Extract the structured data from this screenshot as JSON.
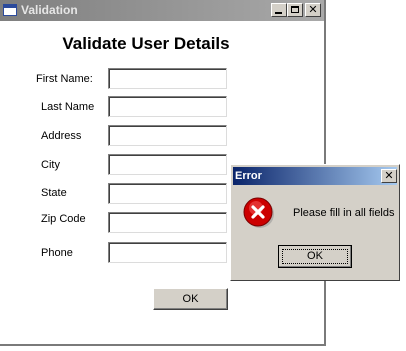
{
  "window": {
    "title": "Validation",
    "controls": {
      "minimize": "minimize-icon",
      "maximize": "maximize-icon",
      "close": "close-icon"
    }
  },
  "form": {
    "heading": "Validate User Details",
    "fields": [
      {
        "label": "First Name:",
        "value": ""
      },
      {
        "label": "Last Name",
        "value": ""
      },
      {
        "label": "Address",
        "value": ""
      },
      {
        "label": "City",
        "value": ""
      },
      {
        "label": "State",
        "value": ""
      },
      {
        "label": "Zip Code",
        "value": ""
      },
      {
        "label": "Phone",
        "value": ""
      }
    ],
    "ok_label": "OK"
  },
  "dialog": {
    "title": "Error",
    "icon": "error-icon",
    "message": "Please fill in all fields",
    "ok_label": "OK",
    "close_glyph": "X"
  },
  "colors": {
    "dialog_title_start": "#0a246a",
    "dialog_title_end": "#a6caf0",
    "error_icon": "#cc0000",
    "inactive_title": "#7f7f7f"
  }
}
